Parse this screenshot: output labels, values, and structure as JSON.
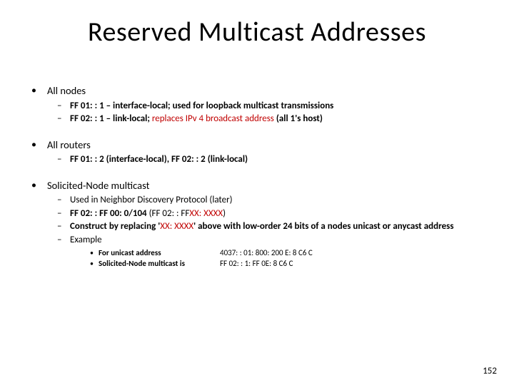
{
  "title": "Reserved Multicast Addresses",
  "bullets": {
    "allnodes": {
      "head": "All nodes",
      "a1": "FF 01: : 1",
      "a1_desc": " – interface-local; used for loopback multicast transmissions",
      "a2": "FF 02: : 1",
      "a2_desc_pre": " – link-local; ",
      "a2_red": "replaces IPv 4 broadcast address",
      "a2_desc_post": " (all 1's host)"
    },
    "allrouters": {
      "head": "All routers",
      "b1_a": "FF 01: : 2",
      "b1_mid": " (interface-local), ",
      "b1_b": "FF 02: : 2",
      "b1_end": " (link-local)"
    },
    "sol": {
      "head": "Solicited-Node multicast",
      "c1": "Used in Neighbor Discovery Protocol (later)",
      "c2_a": "FF 02: : FF 00: 0/104",
      "c2_paren_open": " (FF 02: : FF",
      "c2_red": "XX: XXXX",
      "c2_paren_close": ")",
      "c3_pre": "Construct by replacing '",
      "c3_red": "XX: XXXX",
      "c3_post": "' above with low-order 24 bits of a nodes unicast or anycast address",
      "c4": "Example",
      "ex1_label": "For unicast address",
      "ex1_val": "4037: : 01: 800: 200 E: 8 C6 C",
      "ex2_label": "Solicited-Node multicast is",
      "ex2_val": "FF 02: : 1: FF 0E: 8 C6 C"
    }
  },
  "pagenum": "152"
}
